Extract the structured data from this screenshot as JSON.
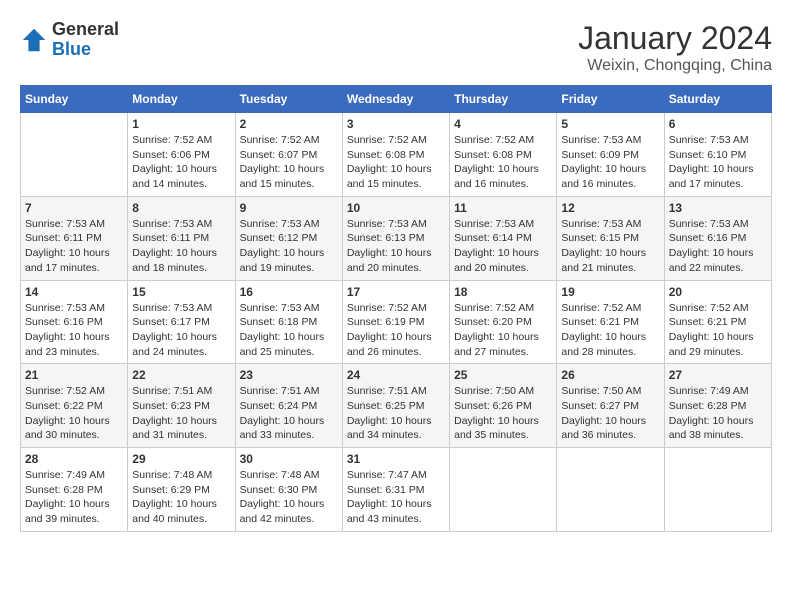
{
  "header": {
    "logo_general": "General",
    "logo_blue": "Blue",
    "month_title": "January 2024",
    "location": "Weixin, Chongqing, China"
  },
  "days_of_week": [
    "Sunday",
    "Monday",
    "Tuesday",
    "Wednesday",
    "Thursday",
    "Friday",
    "Saturday"
  ],
  "weeks": [
    [
      null,
      {
        "num": "1",
        "sunrise": "7:52 AM",
        "sunset": "6:06 PM",
        "daylight": "10 hours and 14 minutes."
      },
      {
        "num": "2",
        "sunrise": "7:52 AM",
        "sunset": "6:07 PM",
        "daylight": "10 hours and 15 minutes."
      },
      {
        "num": "3",
        "sunrise": "7:52 AM",
        "sunset": "6:08 PM",
        "daylight": "10 hours and 15 minutes."
      },
      {
        "num": "4",
        "sunrise": "7:52 AM",
        "sunset": "6:08 PM",
        "daylight": "10 hours and 16 minutes."
      },
      {
        "num": "5",
        "sunrise": "7:53 AM",
        "sunset": "6:09 PM",
        "daylight": "10 hours and 16 minutes."
      },
      {
        "num": "6",
        "sunrise": "7:53 AM",
        "sunset": "6:10 PM",
        "daylight": "10 hours and 17 minutes."
      }
    ],
    [
      {
        "num": "7",
        "sunrise": "7:53 AM",
        "sunset": "6:11 PM",
        "daylight": "10 hours and 17 minutes."
      },
      {
        "num": "8",
        "sunrise": "7:53 AM",
        "sunset": "6:11 PM",
        "daylight": "10 hours and 18 minutes."
      },
      {
        "num": "9",
        "sunrise": "7:53 AM",
        "sunset": "6:12 PM",
        "daylight": "10 hours and 19 minutes."
      },
      {
        "num": "10",
        "sunrise": "7:53 AM",
        "sunset": "6:13 PM",
        "daylight": "10 hours and 20 minutes."
      },
      {
        "num": "11",
        "sunrise": "7:53 AM",
        "sunset": "6:14 PM",
        "daylight": "10 hours and 20 minutes."
      },
      {
        "num": "12",
        "sunrise": "7:53 AM",
        "sunset": "6:15 PM",
        "daylight": "10 hours and 21 minutes."
      },
      {
        "num": "13",
        "sunrise": "7:53 AM",
        "sunset": "6:16 PM",
        "daylight": "10 hours and 22 minutes."
      }
    ],
    [
      {
        "num": "14",
        "sunrise": "7:53 AM",
        "sunset": "6:16 PM",
        "daylight": "10 hours and 23 minutes."
      },
      {
        "num": "15",
        "sunrise": "7:53 AM",
        "sunset": "6:17 PM",
        "daylight": "10 hours and 24 minutes."
      },
      {
        "num": "16",
        "sunrise": "7:53 AM",
        "sunset": "6:18 PM",
        "daylight": "10 hours and 25 minutes."
      },
      {
        "num": "17",
        "sunrise": "7:52 AM",
        "sunset": "6:19 PM",
        "daylight": "10 hours and 26 minutes."
      },
      {
        "num": "18",
        "sunrise": "7:52 AM",
        "sunset": "6:20 PM",
        "daylight": "10 hours and 27 minutes."
      },
      {
        "num": "19",
        "sunrise": "7:52 AM",
        "sunset": "6:21 PM",
        "daylight": "10 hours and 28 minutes."
      },
      {
        "num": "20",
        "sunrise": "7:52 AM",
        "sunset": "6:21 PM",
        "daylight": "10 hours and 29 minutes."
      }
    ],
    [
      {
        "num": "21",
        "sunrise": "7:52 AM",
        "sunset": "6:22 PM",
        "daylight": "10 hours and 30 minutes."
      },
      {
        "num": "22",
        "sunrise": "7:51 AM",
        "sunset": "6:23 PM",
        "daylight": "10 hours and 31 minutes."
      },
      {
        "num": "23",
        "sunrise": "7:51 AM",
        "sunset": "6:24 PM",
        "daylight": "10 hours and 33 minutes."
      },
      {
        "num": "24",
        "sunrise": "7:51 AM",
        "sunset": "6:25 PM",
        "daylight": "10 hours and 34 minutes."
      },
      {
        "num": "25",
        "sunrise": "7:50 AM",
        "sunset": "6:26 PM",
        "daylight": "10 hours and 35 minutes."
      },
      {
        "num": "26",
        "sunrise": "7:50 AM",
        "sunset": "6:27 PM",
        "daylight": "10 hours and 36 minutes."
      },
      {
        "num": "27",
        "sunrise": "7:49 AM",
        "sunset": "6:28 PM",
        "daylight": "10 hours and 38 minutes."
      }
    ],
    [
      {
        "num": "28",
        "sunrise": "7:49 AM",
        "sunset": "6:28 PM",
        "daylight": "10 hours and 39 minutes."
      },
      {
        "num": "29",
        "sunrise": "7:48 AM",
        "sunset": "6:29 PM",
        "daylight": "10 hours and 40 minutes."
      },
      {
        "num": "30",
        "sunrise": "7:48 AM",
        "sunset": "6:30 PM",
        "daylight": "10 hours and 42 minutes."
      },
      {
        "num": "31",
        "sunrise": "7:47 AM",
        "sunset": "6:31 PM",
        "daylight": "10 hours and 43 minutes."
      },
      null,
      null,
      null
    ]
  ],
  "labels": {
    "sunrise": "Sunrise:",
    "sunset": "Sunset:",
    "daylight": "Daylight:"
  }
}
